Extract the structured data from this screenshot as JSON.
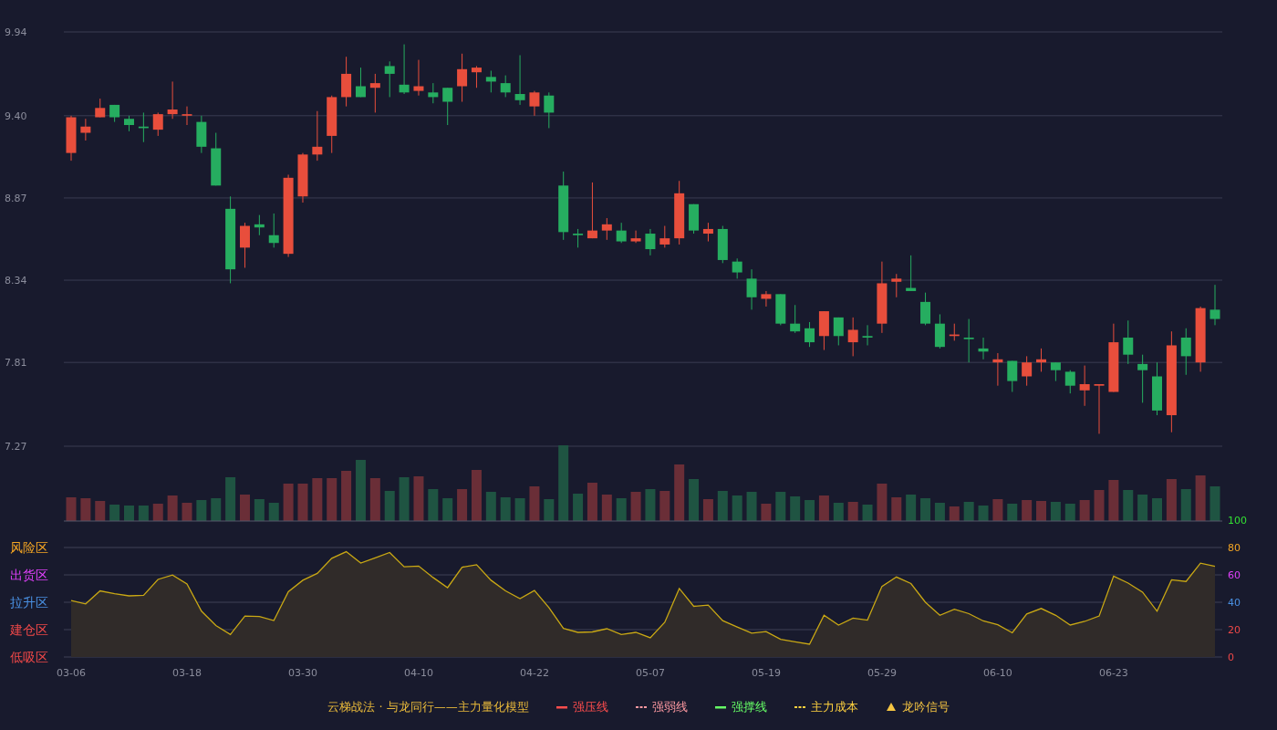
{
  "price_chart": {
    "chart_data": {
      "type": "candlestick",
      "grid": true,
      "ylim": [
        7.27,
        9.94
      ],
      "yticks": [
        {
          "value": 9.94,
          "label": "9.94"
        },
        {
          "value": 9.4,
          "label": "9.40"
        },
        {
          "value": 8.87,
          "label": "8.87"
        },
        {
          "value": 8.34,
          "label": "8.34"
        },
        {
          "value": 7.81,
          "label": "7.81"
        },
        {
          "value": 7.27,
          "label": "7.27"
        }
      ],
      "categories": [
        null,
        null,
        null,
        null,
        null,
        null,
        null,
        null,
        null,
        null,
        null,
        null,
        null,
        null,
        null,
        null,
        null,
        null,
        null,
        null,
        null,
        null,
        null,
        null,
        null,
        null,
        null,
        null,
        null,
        null,
        null,
        null,
        null,
        null,
        null,
        null,
        null,
        null,
        null,
        null,
        null,
        null,
        null,
        null,
        null,
        null,
        null,
        null,
        null,
        null,
        null,
        null,
        null,
        null,
        null,
        null,
        null,
        null,
        null,
        null,
        null,
        null,
        null,
        null,
        null,
        null,
        null,
        null,
        null,
        null,
        null,
        null,
        null,
        null,
        null,
        null,
        null,
        null,
        null,
        null
      ],
      "ohlc": [
        [
          9.16,
          9.4,
          9.11,
          9.39
        ],
        [
          9.29,
          9.38,
          9.24,
          9.33
        ],
        [
          9.39,
          9.51,
          9.39,
          9.45
        ],
        [
          9.47,
          9.47,
          9.36,
          9.39
        ],
        [
          9.38,
          9.4,
          9.3,
          9.34
        ],
        [
          9.33,
          9.42,
          9.23,
          9.32
        ],
        [
          9.31,
          9.42,
          9.27,
          9.41
        ],
        [
          9.41,
          9.62,
          9.38,
          9.44
        ],
        [
          9.4,
          9.46,
          9.34,
          9.41
        ],
        [
          9.36,
          9.4,
          9.16,
          9.2
        ],
        [
          9.19,
          9.29,
          8.95,
          8.95
        ],
        [
          8.8,
          8.88,
          8.32,
          8.41
        ],
        [
          8.55,
          8.71,
          8.42,
          8.69
        ],
        [
          8.7,
          8.76,
          8.63,
          8.68
        ],
        [
          8.63,
          8.77,
          8.55,
          8.58
        ],
        [
          8.51,
          9.02,
          8.49,
          9.0
        ],
        [
          8.88,
          9.16,
          8.84,
          9.15
        ],
        [
          9.15,
          9.43,
          9.11,
          9.2
        ],
        [
          9.27,
          9.53,
          9.16,
          9.52
        ],
        [
          9.52,
          9.78,
          9.46,
          9.67
        ],
        [
          9.59,
          9.71,
          9.52,
          9.52
        ],
        [
          9.58,
          9.67,
          9.42,
          9.61
        ],
        [
          9.72,
          9.75,
          9.52,
          9.67
        ],
        [
          9.6,
          9.86,
          9.54,
          9.55
        ],
        [
          9.56,
          9.76,
          9.53,
          9.59
        ],
        [
          9.55,
          9.61,
          9.48,
          9.52
        ],
        [
          9.58,
          9.58,
          9.34,
          9.49
        ],
        [
          9.59,
          9.8,
          9.49,
          9.7
        ],
        [
          9.68,
          9.72,
          9.58,
          9.71
        ],
        [
          9.65,
          9.69,
          9.55,
          9.62
        ],
        [
          9.61,
          9.66,
          9.52,
          9.55
        ],
        [
          9.54,
          9.79,
          9.47,
          9.5
        ],
        [
          9.46,
          9.56,
          9.4,
          9.55
        ],
        [
          9.53,
          9.55,
          9.32,
          9.42
        ],
        [
          8.95,
          9.04,
          8.6,
          8.65
        ],
        [
          8.64,
          8.67,
          8.55,
          8.63
        ],
        [
          8.61,
          8.97,
          8.61,
          8.66
        ],
        [
          8.66,
          8.74,
          8.6,
          8.7
        ],
        [
          8.66,
          8.71,
          8.58,
          8.59
        ],
        [
          8.59,
          8.66,
          8.58,
          8.61
        ],
        [
          8.64,
          8.67,
          8.5,
          8.54
        ],
        [
          8.57,
          8.69,
          8.55,
          8.61
        ],
        [
          8.61,
          8.98,
          8.57,
          8.9
        ],
        [
          8.83,
          8.83,
          8.64,
          8.66
        ],
        [
          8.64,
          8.71,
          8.59,
          8.67
        ],
        [
          8.67,
          8.69,
          8.45,
          8.47
        ],
        [
          8.46,
          8.48,
          8.35,
          8.39
        ],
        [
          8.35,
          8.41,
          8.15,
          8.23
        ],
        [
          8.22,
          8.27,
          8.17,
          8.25
        ],
        [
          8.25,
          8.25,
          8.05,
          8.06
        ],
        [
          8.06,
          8.18,
          8.0,
          8.01
        ],
        [
          8.03,
          8.07,
          7.91,
          7.94
        ],
        [
          7.98,
          8.14,
          7.89,
          8.14
        ],
        [
          8.1,
          8.1,
          7.92,
          7.98
        ],
        [
          7.94,
          8.1,
          7.85,
          8.02
        ],
        [
          7.98,
          8.05,
          7.92,
          7.97
        ],
        [
          8.06,
          8.46,
          8.0,
          8.32
        ],
        [
          8.33,
          8.38,
          8.23,
          8.35
        ],
        [
          8.29,
          8.5,
          8.27,
          8.27
        ],
        [
          8.2,
          8.26,
          8.05,
          8.06
        ],
        [
          8.06,
          8.12,
          7.9,
          7.91
        ],
        [
          7.98,
          8.06,
          7.95,
          7.99
        ],
        [
          7.97,
          8.09,
          7.81,
          7.96
        ],
        [
          7.9,
          7.97,
          7.83,
          7.88
        ],
        [
          7.81,
          7.87,
          7.66,
          7.83
        ],
        [
          7.82,
          7.82,
          7.62,
          7.69
        ],
        [
          7.72,
          7.85,
          7.66,
          7.81
        ],
        [
          7.81,
          7.9,
          7.75,
          7.83
        ],
        [
          7.81,
          7.81,
          7.69,
          7.76
        ],
        [
          7.75,
          7.76,
          7.61,
          7.66
        ],
        [
          7.63,
          7.79,
          7.53,
          7.67
        ],
        [
          7.66,
          7.67,
          7.35,
          7.67
        ],
        [
          7.62,
          8.06,
          7.62,
          7.94
        ],
        [
          7.97,
          8.08,
          7.8,
          7.86
        ],
        [
          7.8,
          7.86,
          7.55,
          7.76
        ],
        [
          7.72,
          7.81,
          7.47,
          7.5
        ],
        [
          7.47,
          8.01,
          7.36,
          7.92
        ],
        [
          7.97,
          8.03,
          7.73,
          7.85
        ],
        [
          7.81,
          8.17,
          7.75,
          8.16
        ],
        [
          8.15,
          8.31,
          8.05,
          8.09
        ]
      ]
    }
  },
  "indicator_chart": {
    "right_axis": [
      {
        "color": "#33e033"
      },
      {
        "color": "#f5a623"
      },
      {
        "color": "#e040fb"
      },
      {
        "color": "#4a90e2"
      },
      {
        "color": "#f04848"
      },
      {
        "color": "#f04848"
      }
    ],
    "zones": [
      {
        "label": "风险区",
        "color": "#f5a623"
      },
      {
        "label": "出货区",
        "color": "#e040fb"
      },
      {
        "label": "拉升区",
        "color": "#4a90e2"
      },
      {
        "label": "建仓区",
        "color": "#f04848"
      },
      {
        "label": "低吸区",
        "color": "#f04848"
      }
    ],
    "chart_data": {
      "type": "area",
      "grid": true,
      "ylim": [
        0,
        100
      ],
      "yticks": [
        100,
        80,
        60,
        40,
        20,
        0
      ],
      "categories": [
        "03-06",
        null,
        null,
        null,
        null,
        null,
        null,
        null,
        "03-18",
        null,
        null,
        null,
        null,
        null,
        null,
        null,
        "03-30",
        null,
        null,
        null,
        null,
        null,
        null,
        null,
        "04-10",
        null,
        null,
        null,
        null,
        null,
        null,
        null,
        "04-22",
        null,
        null,
        null,
        null,
        null,
        null,
        null,
        "05-07",
        null,
        null,
        null,
        null,
        null,
        null,
        null,
        "05-19",
        null,
        null,
        null,
        null,
        null,
        null,
        null,
        "05-29",
        null,
        null,
        null,
        null,
        null,
        null,
        null,
        "06-10",
        null,
        null,
        null,
        null,
        null,
        null,
        null,
        "06-23",
        null,
        null,
        null,
        null,
        null,
        null,
        null
      ],
      "series": [
        {
          "color": "#c9a814",
          "values": [
            41.2,
            38.8,
            48.3,
            46.2,
            44.7,
            45.1,
            56.7,
            59.9,
            53.4,
            33.5,
            23.0,
            16.5,
            29.9,
            29.6,
            26.6,
            47.7,
            56.1,
            61.1,
            72.1,
            76.9,
            68.6,
            72.4,
            76.3,
            65.9,
            66.5,
            58.1,
            50.7,
            65.6,
            67.4,
            56.1,
            48.3,
            42.7,
            48.6,
            36.1,
            20.9,
            18.0,
            18.3,
            20.7,
            16.5,
            18.0,
            14.1,
            25.4,
            50.1,
            37.0,
            37.9,
            26.6,
            21.9,
            17.4,
            18.6,
            12.9,
            11.1,
            9.3,
            30.5,
            23.3,
            28.4,
            26.9,
            51.6,
            58.5,
            53.7,
            40.0,
            30.5,
            34.9,
            31.7,
            26.3,
            23.6,
            17.7,
            31.4,
            35.5,
            30.5,
            23.3,
            26.0,
            29.9,
            59.1,
            54.0,
            47.4,
            33.5,
            56.4,
            55.2,
            68.6,
            66.2
          ]
        }
      ]
    }
  },
  "legend": {
    "title": "云梯战法 · 与龙同行——主力量化模型",
    "items": [
      {
        "kind": "solid",
        "label": "强压线",
        "color": "#ff4d4d"
      },
      {
        "kind": "dashed",
        "label": "强弱线",
        "color": "#ff9aa2"
      },
      {
        "kind": "solid",
        "label": "强撑线",
        "color": "#66ff66"
      },
      {
        "kind": "dashed",
        "label": "主力成本",
        "color": "#ffd23f"
      },
      {
        "kind": "triangle",
        "label": "龙吟信号",
        "color": "#f5c542"
      }
    ]
  }
}
